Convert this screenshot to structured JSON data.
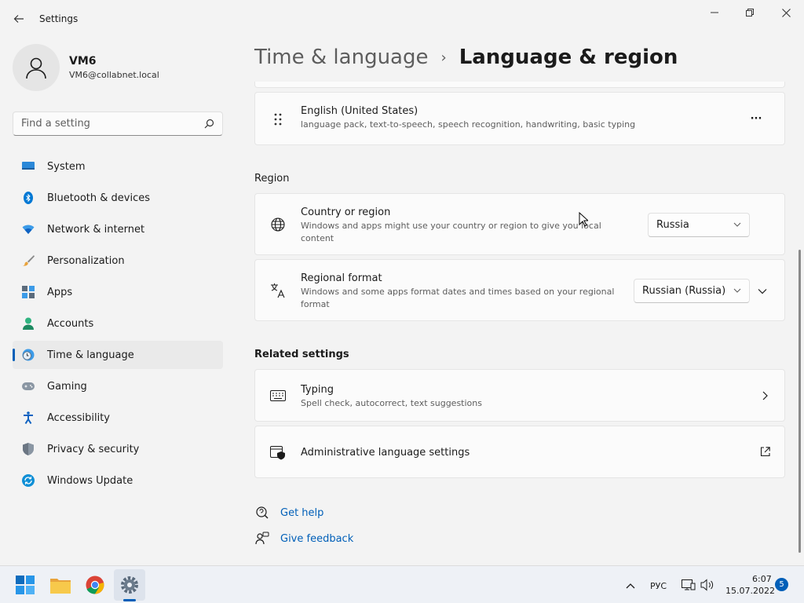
{
  "window": {
    "title": "Settings",
    "back_icon": "back-arrow-icon"
  },
  "profile": {
    "name": "VM6",
    "email": "VM6@collabnet.local"
  },
  "search": {
    "placeholder": "Find a setting"
  },
  "sidebar": {
    "items": [
      {
        "label": "System",
        "icon": "system-icon"
      },
      {
        "label": "Bluetooth & devices",
        "icon": "bluetooth-icon"
      },
      {
        "label": "Network & internet",
        "icon": "network-icon"
      },
      {
        "label": "Personalization",
        "icon": "brush-icon"
      },
      {
        "label": "Apps",
        "icon": "apps-icon"
      },
      {
        "label": "Accounts",
        "icon": "accounts-icon"
      },
      {
        "label": "Time & language",
        "icon": "time-language-icon",
        "active": true
      },
      {
        "label": "Gaming",
        "icon": "gamepad-icon"
      },
      {
        "label": "Accessibility",
        "icon": "accessibility-icon"
      },
      {
        "label": "Privacy & security",
        "icon": "shield-icon"
      },
      {
        "label": "Windows Update",
        "icon": "update-icon"
      }
    ]
  },
  "breadcrumb": {
    "parent": "Time & language",
    "separator": "›",
    "current": "Language & region"
  },
  "language_card": {
    "title": "English (United States)",
    "description": "language pack, text-to-speech, speech recognition, handwriting, basic typing",
    "more": "···"
  },
  "region": {
    "heading": "Region",
    "country": {
      "title": "Country or region",
      "description": "Windows and apps might use your country or region to give you local content",
      "value": "Russia"
    },
    "format": {
      "title": "Regional format",
      "description": "Windows and some apps format dates and times based on your regional format",
      "value": "Russian (Russia)"
    }
  },
  "related": {
    "heading": "Related settings",
    "typing": {
      "title": "Typing",
      "description": "Spell check, autocorrect, text suggestions"
    },
    "admin": {
      "title": "Administrative language settings"
    }
  },
  "help_links": {
    "get_help": "Get help",
    "give_feedback": "Give feedback"
  },
  "taskbar": {
    "language": "РУС",
    "time": "6:07",
    "date": "15.07.2022",
    "notifications": "5"
  },
  "colors": {
    "accent": "#005fb8",
    "background": "#f3f3f3",
    "card": "#fbfbfb"
  }
}
